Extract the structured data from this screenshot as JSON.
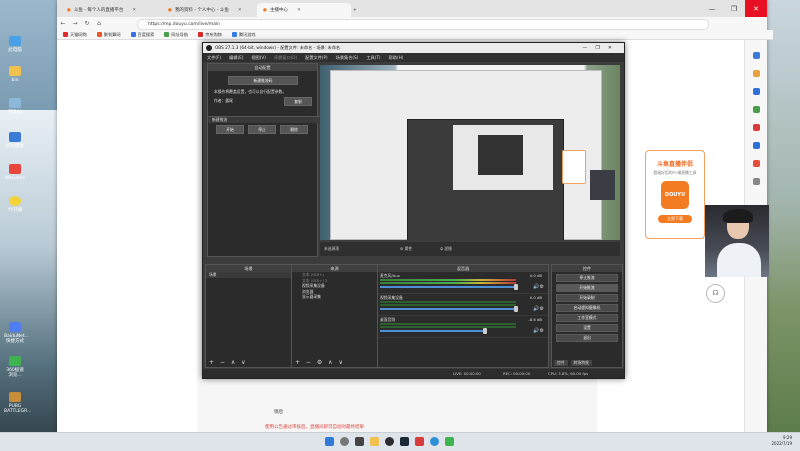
{
  "desktop": {
    "icons": [
      {
        "label": "此电脑",
        "color": "#4aa0e6"
      },
      {
        "label": "bin",
        "color": "#f2c04d"
      },
      {
        "label": "回收站",
        "color": "#8bb7da"
      },
      {
        "label": "控制面板",
        "color": "#3a7bd5"
      },
      {
        "label": "WeGame",
        "color": "#e8463d"
      },
      {
        "label": "YY开播",
        "color": "#f5d33b"
      },
      {
        "label": "BaiduNet... 快捷方式",
        "color": "#4e7ef2"
      },
      {
        "label": "360极速浏览...",
        "color": "#3fb34f"
      },
      {
        "label": "PUBG BATTLEGR...",
        "color": "#c78d3a"
      }
    ]
  },
  "browser": {
    "tabs": [
      {
        "title": "斗鱼 - 每个人的直播平台",
        "active": false
      },
      {
        "title": "我的资料 - 个人中心 - 斗鱼",
        "active": false
      },
      {
        "title": "主播中心",
        "active": true
      }
    ],
    "url": "https://mp.douyu.com/live/main",
    "bookmarks": [
      {
        "label": "天猫网购",
        "color": "#e22b2b"
      },
      {
        "label": "聚划算网",
        "color": "#e8562a"
      },
      {
        "label": "百度搜索",
        "color": "#3b6fe8"
      },
      {
        "label": "网址导航",
        "color": "#4a9d4a"
      },
      {
        "label": "京东购物",
        "color": "#d72a2a"
      },
      {
        "label": "腾讯游戏",
        "color": "#3480e0"
      }
    ],
    "page_text_1": "稍后",
    "page_text_2": "使用公告通过审核后，直播间即可自动对最终结果",
    "window_buttons": [
      "—",
      "❐",
      "✕"
    ]
  },
  "promo": {
    "title": "斗鱼直播伴侣",
    "subtitle": "超级好用的PC端直播工具",
    "logo_text": "DOUYU",
    "button": "立即下载"
  },
  "obs": {
    "title": "OBS 27.1.3 (64-bit, windows) - 配置文件: 未命名 - 场景: 未命名",
    "menu": [
      "文件(F)",
      "编辑(E)",
      "视图(V)",
      "停靠窗口(D)",
      "配置文件(P)",
      "场景集合(S)",
      "工具(T)",
      "帮助(H)"
    ],
    "wizard": {
      "header": "自动配置",
      "new_stream_button": "新建推流码",
      "info_line": "本操作将覆盖设置，也可以自行配置参数。",
      "author_label": "作者：",
      "author_value": "露尾",
      "copy_button": "复制",
      "section_title": "新建推流",
      "start_button": "开始",
      "stop_button": "停止",
      "delete_button": "删除"
    },
    "scene_bar": {
      "left": "未选源项",
      "props": "属性",
      "filters": "滤镜"
    },
    "docks": {
      "scenes": {
        "title": "场景",
        "items": [
          "场景"
        ]
      },
      "sources": {
        "title": "来源",
        "items": [
          "文本 (GDI+)",
          "文本 (GDI+) 2",
          "视频采集设备",
          "浏览器",
          "显示器采集"
        ]
      },
      "mixer": {
        "title": "混音器",
        "channels": [
          {
            "label": "麦克风/Aux",
            "db": "0.0 dB"
          },
          {
            "label": "视频采集设备",
            "db": "0.0 dB"
          },
          {
            "label": "桌面音频",
            "db": "-8.6 dB"
          }
        ]
      },
      "controls": {
        "title": "控件",
        "buttons": [
          "停止推流",
          "开始录制",
          "启动虚拟摄像机",
          "工作室模式",
          "设置",
          "退出"
        ],
        "start_streaming": "开始推流",
        "tabs": [
          "控件",
          "转场特效"
        ]
      }
    },
    "status": {
      "live": "LIVE: 00:00:00",
      "rec": "REC: 00:00:00",
      "cpu": "CPU: 3.8%, 60.00 fps"
    }
  },
  "taskbar": {
    "time": "9:29",
    "date": "2022/7/19"
  }
}
